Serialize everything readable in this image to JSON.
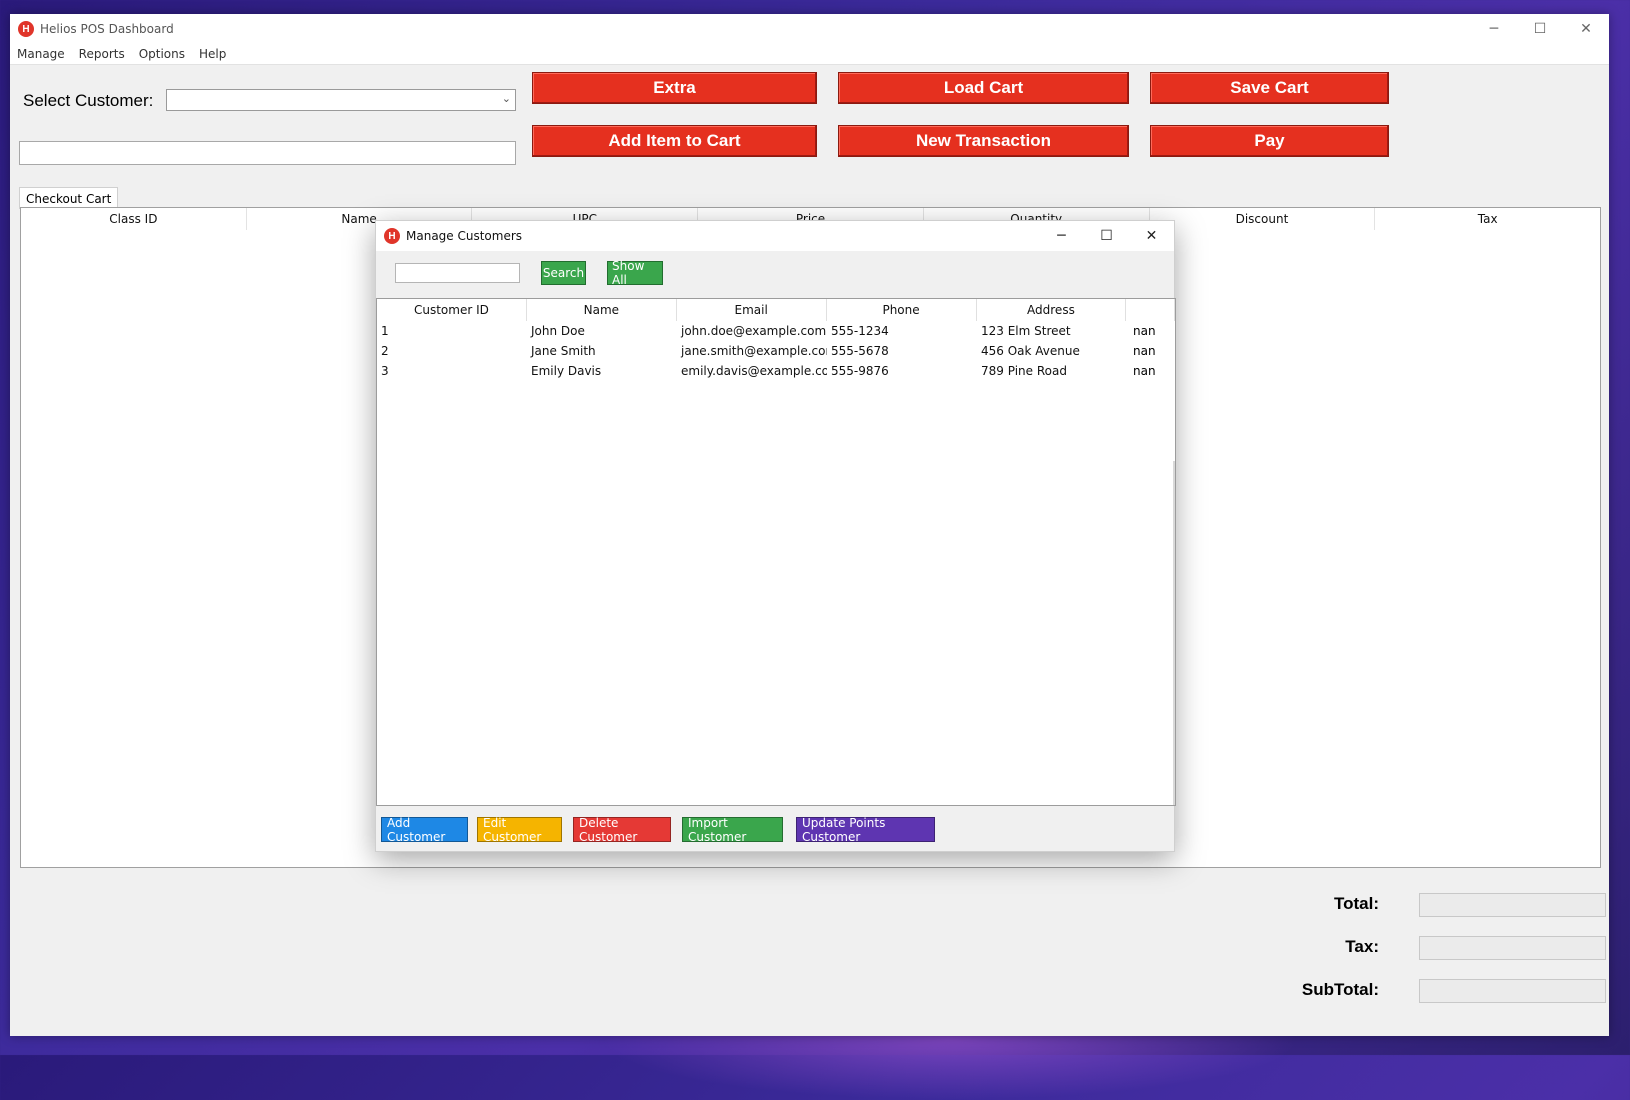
{
  "window": {
    "title": "Helios POS Dashboard",
    "logo_letter": "H",
    "minimize": "─",
    "maximize": "☐",
    "close": "✕"
  },
  "menu": [
    "Manage",
    "Reports",
    "Options",
    "Help"
  ],
  "customer_select": {
    "label": "Select Customer:",
    "value": ""
  },
  "upc_input": {
    "value": ""
  },
  "buttons": {
    "extra": "Extra",
    "load_cart": "Load Cart",
    "save_cart": "Save Cart",
    "add_item": "Add Item to Cart",
    "new_transaction": "New Transaction",
    "pay": "Pay",
    "color": "#e5301f"
  },
  "cart": {
    "tab_label": "Checkout Cart",
    "columns": [
      "Class ID",
      "Name",
      "UPC",
      "Price",
      "Quantity",
      "Discount",
      "Tax"
    ]
  },
  "totals": {
    "total_label": "Total:",
    "tax_label": "Tax:",
    "subtotal_label": "SubTotal:"
  },
  "dialog": {
    "title": "Manage Customers",
    "logo_letter": "H",
    "search_value": "",
    "search_label": "Search",
    "show_all_label": "Show All",
    "columns": [
      "Customer ID",
      "Name",
      "Email",
      "Phone",
      "Address",
      ""
    ],
    "rows": [
      {
        "id": "1",
        "name": "John Doe",
        "email": "john.doe@example.com",
        "phone": "555-1234",
        "address": "123 Elm Street",
        "extra": "nan"
      },
      {
        "id": "2",
        "name": "Jane Smith",
        "email": "jane.smith@example.com",
        "phone": "555-5678",
        "address": "456 Oak Avenue",
        "extra": "nan"
      },
      {
        "id": "3",
        "name": "Emily Davis",
        "email": "emily.davis@example.com",
        "phone": "555-9876",
        "address": "789 Pine Road",
        "extra": "nan"
      }
    ],
    "actions": {
      "add": "Add Customer",
      "edit": "Edit Customer",
      "delete": "Delete Customer",
      "import": "Import Customer",
      "update_points": "Update Points Customer"
    },
    "action_colors": {
      "add": "#1e88e5",
      "edit": "#f5b400",
      "delete": "#e53935",
      "import": "#3aa64c",
      "update_points": "#5e35b1"
    }
  }
}
